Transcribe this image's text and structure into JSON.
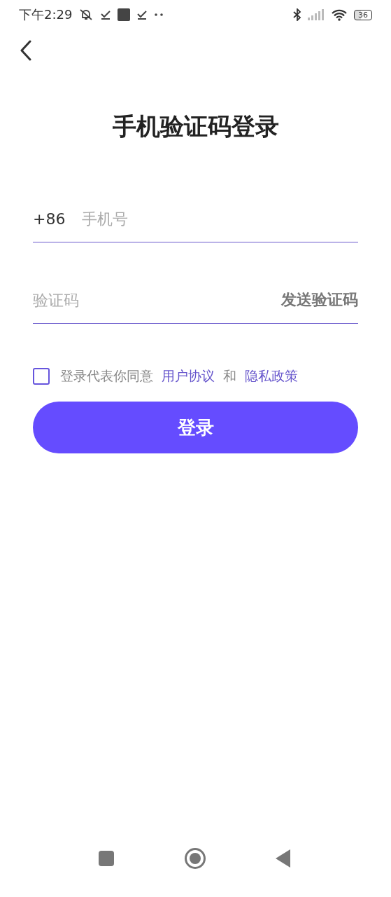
{
  "status_bar": {
    "time": "下午2:29",
    "battery": "36"
  },
  "title": "手机验证码登录",
  "phone_field": {
    "prefix": "+86",
    "placeholder": "手机号"
  },
  "code_field": {
    "placeholder": "验证码",
    "action": "发送验证码"
  },
  "agreement": {
    "checked": false,
    "text": "登录代表你同意",
    "link1": "用户协议",
    "joiner": "和",
    "link2": "隐私政策"
  },
  "login_button": "登录"
}
